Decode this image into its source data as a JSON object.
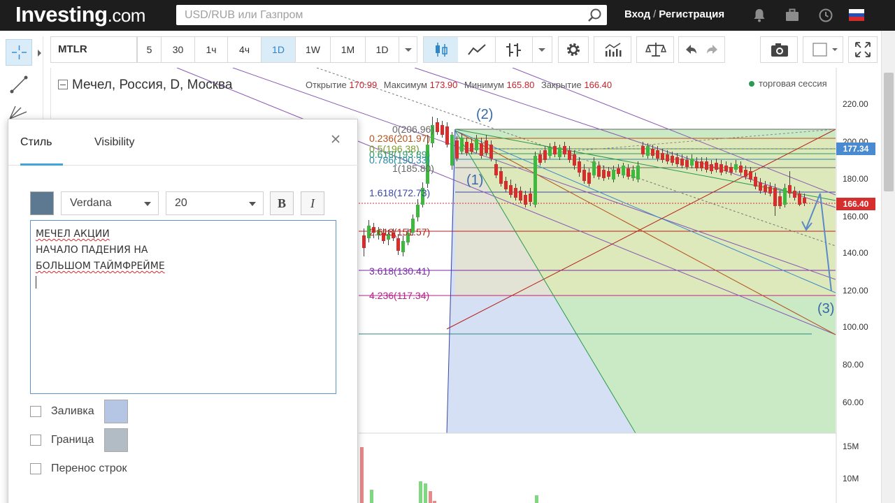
{
  "navbar": {
    "logo_main": "Investing",
    "logo_suffix": ".com",
    "search_placeholder": "USD/RUB или Газпром",
    "login": "Вход",
    "register": "Регистрация",
    "separator": "/"
  },
  "toolbar": {
    "symbol": "MTLR",
    "intervals": [
      "5",
      "30",
      "1ч",
      "4ч",
      "1D",
      "1W",
      "1M",
      "1D"
    ],
    "active_interval_index": 4
  },
  "chart": {
    "title": "Мечел, Россия, D, Москва",
    "open_label": "Открытие",
    "open_value": "170.99",
    "high_label": "Максимум",
    "high_value": "173.90",
    "low_label": "Минимум",
    "low_value": "165.80",
    "close_label": "Закрытие",
    "close_value": "166.40",
    "session_label": "торговая сессия",
    "price_tag_blue": "177.34",
    "price_tag_red": "166.40",
    "axis_labels": [
      "220.00",
      "200.00",
      "180.00",
      "160.00",
      "140.00",
      "120.00",
      "100.00",
      "80.00",
      "60.00"
    ],
    "volume_labels": [
      "15M",
      "10M"
    ],
    "fib_labels": [
      {
        "text": "0(206.96)",
        "color": "#666666"
      },
      {
        "text": "0.236(201.97)",
        "color": "#b5521a"
      },
      {
        "text": "0.5(196.38)",
        "color": "#7a9a2a"
      },
      {
        "text": "0.618(193.89)",
        "color": "#2a9a6a"
      },
      {
        "text": "0.786(190.33)",
        "color": "#2a8aa6"
      },
      {
        "text": "1(185.80)",
        "color": "#666666"
      },
      {
        "text": "1.618(172.73)",
        "color": "#3a4aa6"
      },
      {
        "text": "2.618(151.57)",
        "color": "#b5221a"
      },
      {
        "text": "3.618(130.41)",
        "color": "#7a2aa6"
      },
      {
        "text": "4.236(117.34)",
        "color": "#b5228a"
      }
    ],
    "wave_labels": [
      "(1)",
      "(2)",
      "(3)"
    ],
    "colors": {
      "up": "#3fb83f",
      "down": "#d62d2d",
      "fib_fill": "#b4c6ec",
      "green_fill": "#c6ecb4"
    }
  },
  "dialog": {
    "tab_style": "Стиль",
    "tab_visibility": "Visibility",
    "font_family": "Verdana",
    "font_size": "20",
    "bold_label": "B",
    "italic_label": "I",
    "text_lines": [
      "МЕЧЕЛ АКЦИИ",
      "НАЧАЛО ПАДЕНИЯ НА",
      "БОЛЬШОМ ТАЙМФРЕЙМЕ"
    ],
    "fill_label": "Заливка",
    "border_label": "Граница",
    "wrap_label": "Перенос строк",
    "text_color": "#5d7891",
    "fill_color": "#b4c6e4",
    "border_color": "#b2bcc4"
  }
}
